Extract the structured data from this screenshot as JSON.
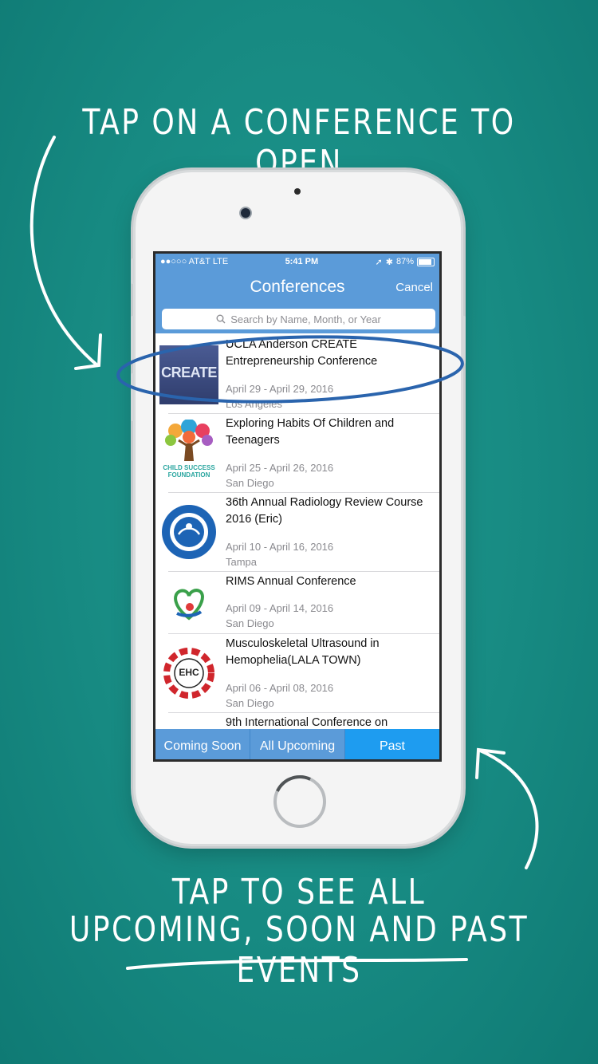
{
  "captions": {
    "top": "TAP ON A CONFERENCE TO OPEN",
    "bottom_line1": "TAP TO SEE ALL",
    "bottom_line2": "UPCOMING, SOON AND PAST EVENTS"
  },
  "colors": {
    "background": "#178a82",
    "nav_blue": "#5b9bd9",
    "active_tab": "#1e9cf0",
    "highlight_ellipse": "#2a64ad"
  },
  "status_bar": {
    "carrier": "●●○○○ AT&T  LTE",
    "time": "5:41 PM",
    "battery": "87%"
  },
  "nav": {
    "title": "Conferences",
    "cancel_label": "Cancel"
  },
  "search": {
    "icon": "search-icon",
    "placeholder": "Search by Name, Month, or Year"
  },
  "conferences": [
    {
      "title": "UCLA Anderson CREATE Entrepreneurship Conference",
      "dates": "April 29 - April 29, 2016",
      "location": "Los Angeles",
      "logo_text": "CREATE"
    },
    {
      "title": "Exploring Habits Of Children and Teenagers",
      "dates": "April 25 - April 26, 2016",
      "location": "San Diego",
      "logo_text": "CHILD SUCCESS",
      "logo_text2": "FOUNDATION"
    },
    {
      "title": "36th Annual Radiology Review Course 2016 (Eric)",
      "dates": "April 10 - April 16, 2016",
      "location": "Tampa"
    },
    {
      "title": "RIMS Annual Conference",
      "dates": "April 09 - April 14, 2016",
      "location": "San Diego"
    },
    {
      "title": "Musculoskeletal Ultrasound in Hemophelia(LALA TOWN)",
      "dates": "April 06 - April 08, 2016",
      "location": "San Diego",
      "logo_text": "EHC"
    },
    {
      "title": "9th International Conference on"
    }
  ],
  "tabs": [
    {
      "label": "Coming Soon",
      "active": false
    },
    {
      "label": "All Upcoming",
      "active": false
    },
    {
      "label": "Past",
      "active": true
    }
  ]
}
